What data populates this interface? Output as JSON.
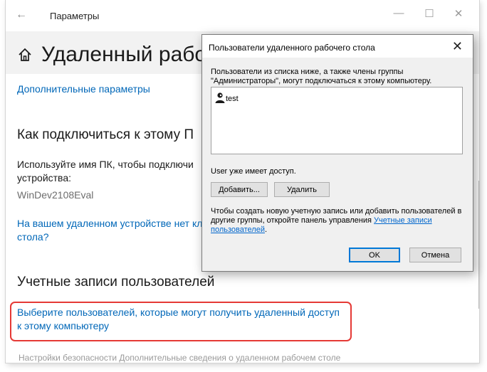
{
  "window": {
    "title": "Параметры",
    "back_icon": "back-arrow-icon",
    "controls": [
      "—",
      "☐",
      "✕"
    ]
  },
  "page": {
    "title": "Удаленный рабочи",
    "advanced_link": "Дополнительные параметры",
    "connect_heading": "Как подключиться к этому П",
    "use_pc_name_line1": "Используйте имя ПК, чтобы подключи",
    "use_pc_name_line2": "устройства:",
    "pc_name": "WinDev2108Eval",
    "no_client_line1": "На вашем удаленном устройстве нет кли",
    "no_client_line2": "стола?",
    "accounts_heading": "Учетные записи пользователей",
    "select_users_line1": "Выберите пользователей, которые могут получить удаленный доступ",
    "select_users_line2": "к этому компьютеру",
    "bottom_hidden_text": "Настройки безопасности                    Дополнительные сведения о удаленном рабочем столе"
  },
  "dialog": {
    "title": "Пользователи удаленного рабочего стола",
    "description_line1": "Пользователи из списка ниже, а также члены группы",
    "description_line2": "\"Администраторы\", могут подключаться к этому компьютеру.",
    "users": [
      {
        "name": "test",
        "icon": "user-icon"
      }
    ],
    "user_access_text": "User уже имеет доступ.",
    "add_button": "Добавить...",
    "remove_button": "Удалить",
    "info_line1": "Чтобы создать новую учетную запись или добавить пользователей в",
    "info_line2_prefix": "другие группы, откройте панель управления ",
    "info_link_part1": "Учетные записи",
    "info_link_part2": "пользователей",
    "info_suffix": ".",
    "ok_button": "OK",
    "cancel_button": "Отмена"
  },
  "colors": {
    "link": "#0067b8",
    "highlight": "#e53935",
    "dialog_bg": "#f0f0f0"
  }
}
